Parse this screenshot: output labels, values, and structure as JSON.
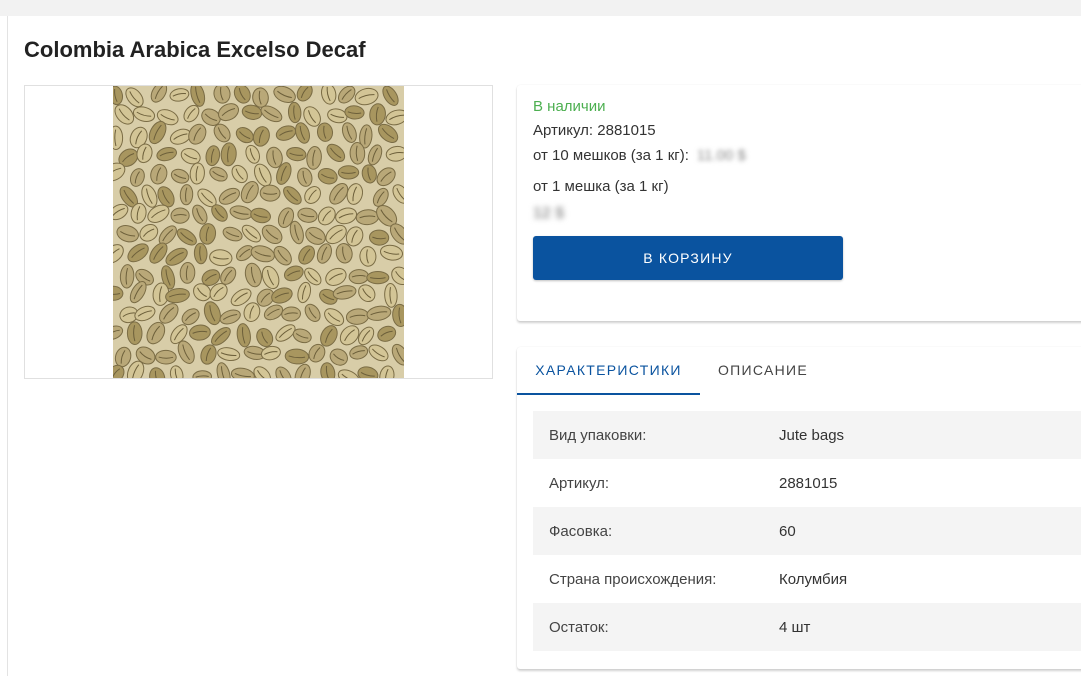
{
  "product": {
    "title": "Colombia Arabica Excelso Decaf"
  },
  "price_card": {
    "stock_status": "В наличии",
    "sku_line": "Артикул: 2881015",
    "bulk_label": "от 10 мешков (за 1 кг):",
    "bulk_price_blurred": "11.00 $",
    "single_label": "от 1 мешка (за 1 кг)",
    "single_price_blurred": "12 $",
    "cart_button": "В КОРЗИНУ"
  },
  "tabs": [
    {
      "label": "ХАРАКТЕРИСТИКИ",
      "active": true
    },
    {
      "label": "ОПИСАНИЕ",
      "active": false
    }
  ],
  "specs": [
    {
      "key": "Вид упаковки:",
      "value": "Jute bags"
    },
    {
      "key": "Артикул:",
      "value": "2881015"
    },
    {
      "key": "Фасовка:",
      "value": "60"
    },
    {
      "key": "Страна происхождения:",
      "value": "Колумбия"
    },
    {
      "key": "Остаток:",
      "value": "4 шт"
    }
  ],
  "colors": {
    "accent": "#0a539f",
    "stock_green": "#4caf50",
    "row_shade": "#f4f4f4"
  }
}
